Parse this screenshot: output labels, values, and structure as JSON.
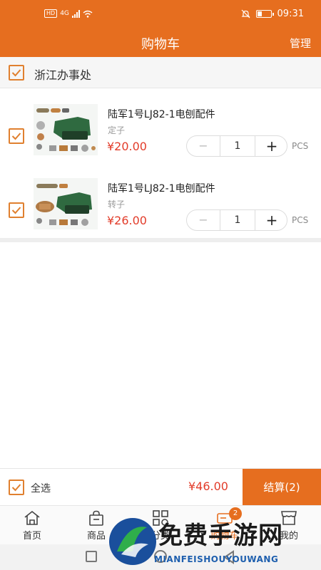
{
  "status_bar": {
    "left_badges": [
      "HD",
      "4G"
    ],
    "time": "09:31",
    "icons": [
      "signal-icon",
      "wifi-icon",
      "mute-icon",
      "battery-icon"
    ]
  },
  "header": {
    "title": "购物车",
    "manage_label": "管理"
  },
  "shop": {
    "name": "浙江办事处",
    "checked": true
  },
  "items": [
    {
      "name": "陆军1号LJ82-1电刨配件",
      "spec": "定子",
      "price": "¥20.00",
      "quantity": "1",
      "unit": "PCS",
      "checked": true,
      "minus": "−",
      "plus": "+"
    },
    {
      "name": "陆军1号LJ82-1电刨配件",
      "spec": "转子",
      "price": "¥26.00",
      "quantity": "1",
      "unit": "PCS",
      "checked": true,
      "minus": "−",
      "plus": "+"
    }
  ],
  "checkout": {
    "select_all_label": "全选",
    "total": "¥46.00",
    "settle_label": "结算(2)"
  },
  "tabs": [
    {
      "label": "首页",
      "icon": "home-icon"
    },
    {
      "label": "商品",
      "icon": "shopping-bag-icon"
    },
    {
      "label": "分类",
      "icon": "grid-icon"
    },
    {
      "label": "购物车",
      "icon": "cart-icon",
      "active": true,
      "badge": "2"
    },
    {
      "label": "我的",
      "icon": "store-icon"
    }
  ],
  "watermark": {
    "text": "免费手游网",
    "subtext": "MIANFEISHOUYOUWANG"
  },
  "colors": {
    "brand": "#e66e1f",
    "price": "#e23c2a",
    "checkbox": "#e0802f"
  }
}
